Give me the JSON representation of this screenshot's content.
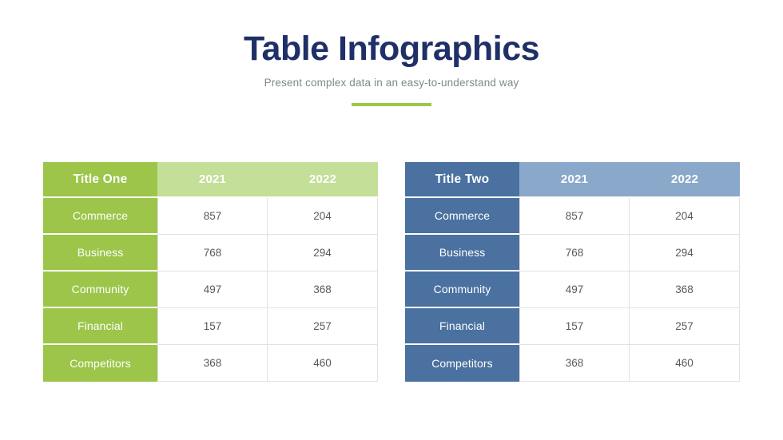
{
  "header": {
    "title": "Table Infographics",
    "subtitle": "Present complex data in an easy-to-understand way",
    "accent_color": "#9cc54a",
    "title_color": "#1f3068",
    "subtitle_color": "#7e8a8c"
  },
  "tables": [
    {
      "id": "table-green",
      "theme": "green",
      "colors": {
        "header_primary": "#9cc54a",
        "header_secondary": "#c4df97",
        "label_cell": "#9cc54a",
        "value_text": "#595959",
        "cell_border": "#e2e2e2"
      },
      "columns": [
        "Title One",
        "2021",
        "2022"
      ],
      "rows": [
        {
          "label": "Commerce",
          "y2021": "857",
          "y2022": "204"
        },
        {
          "label": "Business",
          "y2021": "768",
          "y2022": "294"
        },
        {
          "label": "Community",
          "y2021": "497",
          "y2022": "368"
        },
        {
          "label": "Financial",
          "y2021": "157",
          "y2022": "257"
        },
        {
          "label": "Competitors",
          "y2021": "368",
          "y2022": "460"
        }
      ]
    },
    {
      "id": "table-blue",
      "theme": "blue",
      "colors": {
        "header_primary": "#4a719f",
        "header_secondary": "#8aa8ca",
        "label_cell": "#4a719f",
        "value_text": "#595959",
        "cell_border": "#e2e2e2"
      },
      "columns": [
        "Title Two",
        "2021",
        "2022"
      ],
      "rows": [
        {
          "label": "Commerce",
          "y2021": "857",
          "y2022": "204"
        },
        {
          "label": "Business",
          "y2021": "768",
          "y2022": "294"
        },
        {
          "label": "Community",
          "y2021": "497",
          "y2022": "368"
        },
        {
          "label": "Financial",
          "y2021": "157",
          "y2022": "257"
        },
        {
          "label": "Competitors",
          "y2021": "368",
          "y2022": "460"
        }
      ]
    }
  ]
}
